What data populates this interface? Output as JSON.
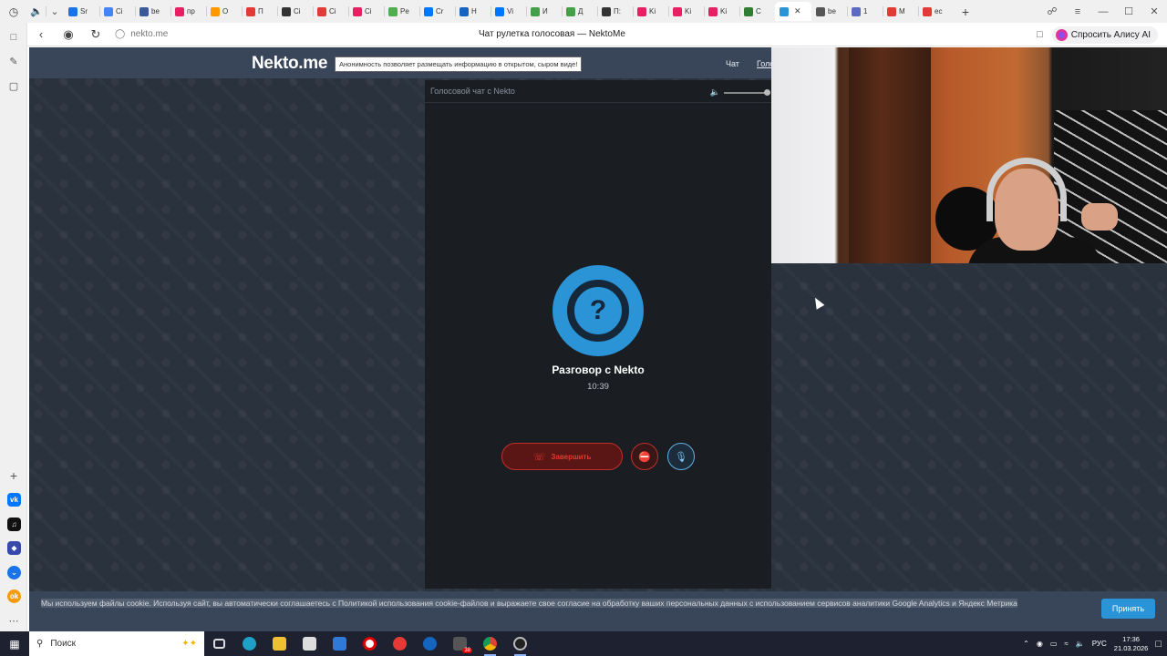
{
  "browser": {
    "tabs": [
      {
        "label": "Sr",
        "color": "#1a73e8"
      },
      {
        "label": "Ci",
        "color": "#4285f4"
      },
      {
        "label": "be",
        "color": "#3b5998"
      },
      {
        "label": "пр",
        "color": "#e91e63"
      },
      {
        "label": "O",
        "color": "#ff9800"
      },
      {
        "label": "П",
        "color": "#e53935"
      },
      {
        "label": "Ci",
        "color": "#333333"
      },
      {
        "label": "Ci",
        "color": "#e53935"
      },
      {
        "label": "Ci",
        "color": "#e91e63"
      },
      {
        "label": "Pe",
        "color": "#4caf50"
      },
      {
        "label": "Cr",
        "color": "#0077ff"
      },
      {
        "label": "H",
        "color": "#1565c0"
      },
      {
        "label": "Vi",
        "color": "#0077ff"
      },
      {
        "label": "И",
        "color": "#43a047"
      },
      {
        "label": "Д",
        "color": "#43a047"
      },
      {
        "label": "П:",
        "color": "#333333"
      },
      {
        "label": "Ki",
        "color": "#e91e63"
      },
      {
        "label": "Ki",
        "color": "#e91e63"
      },
      {
        "label": "Ki",
        "color": "#e91e63"
      },
      {
        "label": "C",
        "color": "#2e7d32"
      }
    ],
    "active_tab_label": "",
    "tabs_after": [
      {
        "label": "be",
        "color": "#555555"
      },
      {
        "label": "1",
        "color": "#5c6bc0"
      },
      {
        "label": "M",
        "color": "#e53935"
      },
      {
        "label": "ec",
        "color": "#e53935"
      }
    ],
    "url": "nekto.me",
    "page_title": "Чат рулетка голосовая — NektoMe",
    "alice_label": "Спросить Алису AI"
  },
  "site": {
    "logo": "Nekto.me",
    "notice": "Анонимность позволяет размещать информацию в открытом, сыром виде!",
    "nav_chat": "Чат",
    "nav_voice": "Голо"
  },
  "chat": {
    "header": "Голосовой чат с Nekto",
    "avatar_symbol": "?",
    "title": "Разговор с Nekto",
    "timer": "10:39",
    "end_label": "Завершить"
  },
  "cookie": {
    "text": "Мы используем файлы cookie. Используя сайт, вы автоматически соглашаетесь с Политикой использования cookie-файлов и выражаете свое согласие на обработку ваших персональных данных с использованием сервисов аналитики Google Analytics и Яндекс Метрика",
    "accept": "Принять"
  },
  "taskbar": {
    "search_placeholder": "Поиск",
    "language": "РУС",
    "time": "17:36",
    "date": "21.03.2026",
    "badge_count": "38"
  },
  "colors": {
    "accent": "#2a94d6",
    "danger": "#e23a2e",
    "page_bg": "#2a323d",
    "panel_bg": "#1a1e23",
    "header_bg": "#39465a"
  }
}
